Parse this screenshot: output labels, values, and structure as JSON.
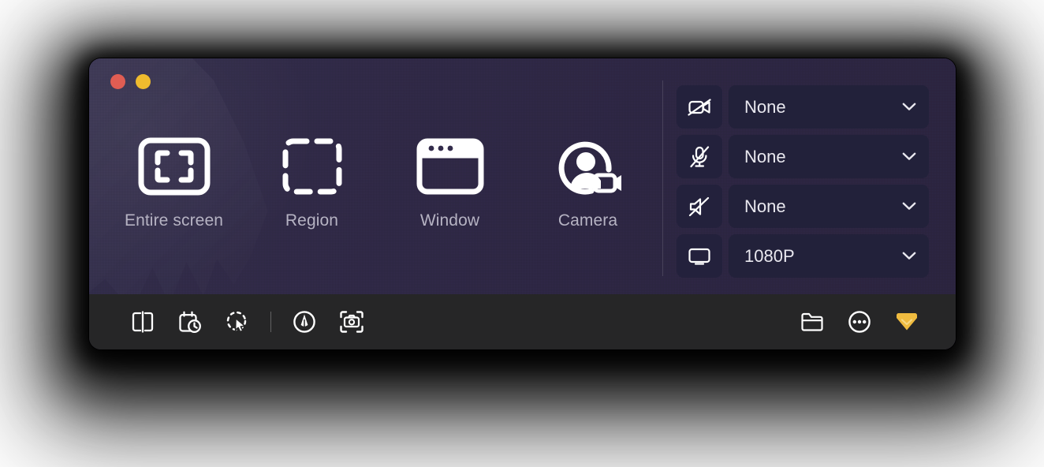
{
  "window": {
    "traffic_lights": [
      {
        "name": "close",
        "color": "#e05d53"
      },
      {
        "name": "minimize",
        "color": "#efbb2e"
      }
    ]
  },
  "capture_modes": [
    {
      "id": "entire-screen",
      "label": "Entire screen",
      "icon": "fullscreen-frame-icon"
    },
    {
      "id": "region",
      "label": "Region",
      "icon": "dashed-rectangle-icon"
    },
    {
      "id": "window",
      "label": "Window",
      "icon": "browser-window-icon"
    },
    {
      "id": "camera",
      "label": "Camera",
      "icon": "person-camera-icon"
    }
  ],
  "settings": [
    {
      "id": "camera",
      "icon": "camera-off-icon",
      "value": "None",
      "chevron": "chevron-down-icon"
    },
    {
      "id": "microphone",
      "icon": "microphone-off-icon",
      "value": "None",
      "chevron": "chevron-down-icon"
    },
    {
      "id": "system-audio",
      "icon": "speaker-muted-icon",
      "value": "None",
      "chevron": "chevron-down-icon"
    },
    {
      "id": "resolution",
      "icon": "display-icon",
      "value": "1080P",
      "chevron": "chevron-down-icon"
    }
  ],
  "toolbar": {
    "left": [
      {
        "id": "split-view",
        "icon": "split-panel-icon"
      },
      {
        "id": "scheduled-capture",
        "icon": "calendar-clock-icon"
      },
      {
        "id": "click-highlight",
        "icon": "cursor-highlight-icon"
      }
    ],
    "right": [
      {
        "id": "annotate",
        "icon": "pen-circle-icon"
      },
      {
        "id": "screenshot",
        "icon": "camera-frame-icon"
      }
    ],
    "end": [
      {
        "id": "open-folder",
        "icon": "folder-icon"
      },
      {
        "id": "more",
        "icon": "more-circle-icon"
      },
      {
        "id": "upgrade",
        "icon": "diamond-icon",
        "color": "#efbb3f"
      }
    ]
  },
  "colors": {
    "stage_bg": "#322a4a",
    "toolbar_bg": "#262627",
    "field_bg": "#22213a",
    "icon_btn_bg": "#23213c",
    "label_text": "#b6b3c3",
    "value_text": "#e9e8ef",
    "accent_gold": "#efbb3f"
  }
}
